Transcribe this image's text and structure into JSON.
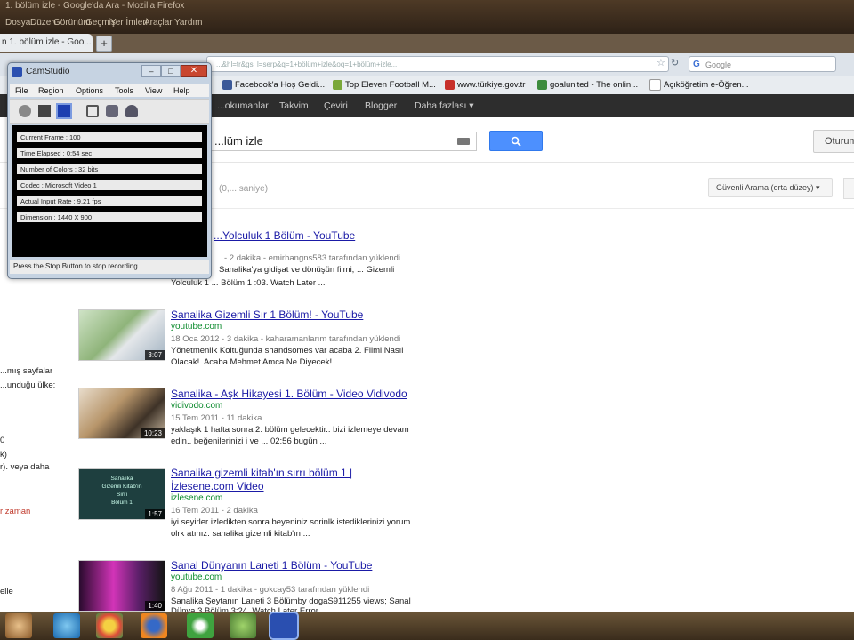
{
  "browser": {
    "window_title": "1. bölüm izle - Google'da Ara - Mozilla Firefox",
    "menu": [
      "Dosya",
      "Düzen",
      "Görünüm",
      "Geçmiş",
      "Yer İmleri",
      "Araçlar",
      "Yardım"
    ],
    "tab_label": "n 1. bölüm izle - Goo...",
    "newtab_label": "+",
    "url": "...&hl=tr&gs_l=serp&q=1+bölüm+izle&oq=1+bölüm+izle...",
    "search_box_logo": "G",
    "search_placeholder": "Google",
    "bookmarks": [
      "Facebook'a Hoş Geldi...",
      "Top Eleven Football M...",
      "www.türkiye.gov.tr",
      "goalunited - The onlin...",
      "Açıköğretim e-Öğren..."
    ]
  },
  "google_bar": [
    "...okumanlar",
    "Takvim",
    "Çeviri",
    "Blogger",
    "Daha fazlası ▾"
  ],
  "search": {
    "query": "...lüm izle",
    "button_icon": "search-icon",
    "signin_label": "Oturum",
    "stats": "(0,... saniye)",
    "safesearch_label": "Güvenli Arama (orta düzey) ▾"
  },
  "results": [
    {
      "title": "...Yolculuk 1 Bölüm - YouTube",
      "meta": "- 2 dakika - emirhangns583 tarafından yüklendi",
      "snippet1": "Sanalika'ya gidişat ve dönüşün filmi, ... Gizemli",
      "snippet2": "Yolculuk 1 ... Bölüm 1 :03. Watch Later ..."
    },
    {
      "title": "Sanalika Gizemli Sır 1 Bölüm! - YouTube",
      "url": "youtube.com",
      "meta": "18 Oca 2012 - 3 dakika - kaharamanlarım tarafından yüklendi",
      "snippet1": "Yönetmenlik Koltuğunda shandsomes var acaba 2. Filmi Nasıl",
      "snippet2": "Olacak!. Acaba Mehmet Amca Ne Diyecek!",
      "duration": "3:07"
    },
    {
      "title": "Sanalika - Aşk Hikayesi 1. Bölüm - Video Vidivodo",
      "url": "vidivodo.com",
      "meta": "15 Tem 2011 - 11 dakika",
      "snippet1": "yaklaşık 1 hafta sonra 2. bölüm gelecektir.. bizi izlemeye devam",
      "snippet2": "edin.. beğenilerinizi i ve ... 02:56 bugün ...",
      "duration": "10:23"
    },
    {
      "title": "Sanalika gizemli kitab'ın sırrı bölüm 1 |",
      "title2": "İzlesene.com Video",
      "url": "izlesene.com",
      "meta": "16 Tem 2011 - 2 dakika",
      "snippet1": "iyi seyirler izledikten sonra beyeniniz sorinlk istediklerinizi yorum",
      "snippet2": "olrk atınız. sanalika gizemli kitab'ın ...",
      "thumb_lines": [
        "Sanalika",
        "Gizemli Kitab'ın",
        "Sırrı",
        "Bölüm 1"
      ],
      "duration": "1:57"
    },
    {
      "title": "Sanal Dünyanın Laneti 1 Bölüm - YouTube",
      "url": "youtube.com",
      "meta": "8 Ağu 2011 - 1 dakika - gokcay53 tarafından yüklendi",
      "snippet1": "Sanalika Şeytanın Laneti 3 Bölümby dogaS911255 views; Sanal",
      "snippet2": "Dünya 3 Bölüm 3:24. Watch Later Error ...",
      "duration": "1:40"
    }
  ],
  "left_fragments": [
    "...mış sayfalar",
    "...unduğu ülke:",
    "0",
    "k)",
    "r). veya daha",
    "r zaman",
    "elle"
  ],
  "camstudio": {
    "title": "CamStudio",
    "min": "–",
    "max": "□",
    "close": "✕",
    "menu": [
      "File",
      "Region",
      "Options",
      "Tools",
      "View",
      "Help"
    ],
    "stats": [
      "Current Frame : 100",
      "Time Elapsed : 0:54 sec",
      "Number of Colors : 32 bits",
      "Codec : Microsoft Video 1",
      "Actual Input Rate : 9.21 fps",
      "Dimension : 1440 X 900"
    ],
    "status": "Press the Stop Button to stop recording"
  },
  "taskbar_icons": [
    "start-orb-icon",
    "folder-icon",
    "internet-explorer-icon",
    "chrome-icon",
    "firefox-icon",
    "utorrent-icon",
    "network-icon",
    "camstudio-icon"
  ],
  "colors": {
    "link": "#1a1aa6",
    "url": "#0b8a2c",
    "google_blue": "#4d90fe",
    "gbar": "#2d2d2d"
  }
}
